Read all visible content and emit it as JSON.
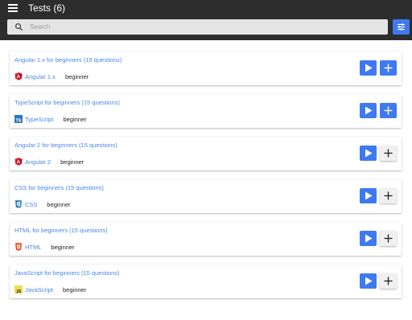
{
  "header": {
    "title": "Tests (6)",
    "menu_icon": "menu-icon",
    "search": {
      "placeholder": "Search",
      "value": ""
    },
    "filter_icon": "tune-icon"
  },
  "colors": {
    "header_bg": "#2d2d2d",
    "accent": "#3f79f0",
    "link": "#4a86e8",
    "search_bg": "#e4e4e4"
  },
  "tests": [
    {
      "title": "Angular 1.x for beginners (15 questions)",
      "technology": "Angular 1.x",
      "icon": "angular-icon",
      "level": "beginner",
      "add_style": "primary"
    },
    {
      "title": "TypeScript for beginners (15 questions)",
      "technology": "TypeScript",
      "icon": "typescript-icon",
      "level": "beginner",
      "add_style": "primary"
    },
    {
      "title": "Angular 2 for beginners (15 questions)",
      "technology": "Angular 2",
      "icon": "angular-icon",
      "level": "beginner",
      "add_style": "secondary"
    },
    {
      "title": "CSS for beginners (15 questions)",
      "technology": "CSS",
      "icon": "css3-icon",
      "level": "beginner",
      "add_style": "secondary"
    },
    {
      "title": "HTML for beginners (15 questions)",
      "technology": "HTML",
      "icon": "html5-icon",
      "level": "beginner",
      "add_style": "secondary"
    },
    {
      "title": "JavaScript for beginners (15 questions)",
      "technology": "JavaScript",
      "icon": "javascript-icon",
      "level": "beginner",
      "add_style": "secondary"
    }
  ]
}
